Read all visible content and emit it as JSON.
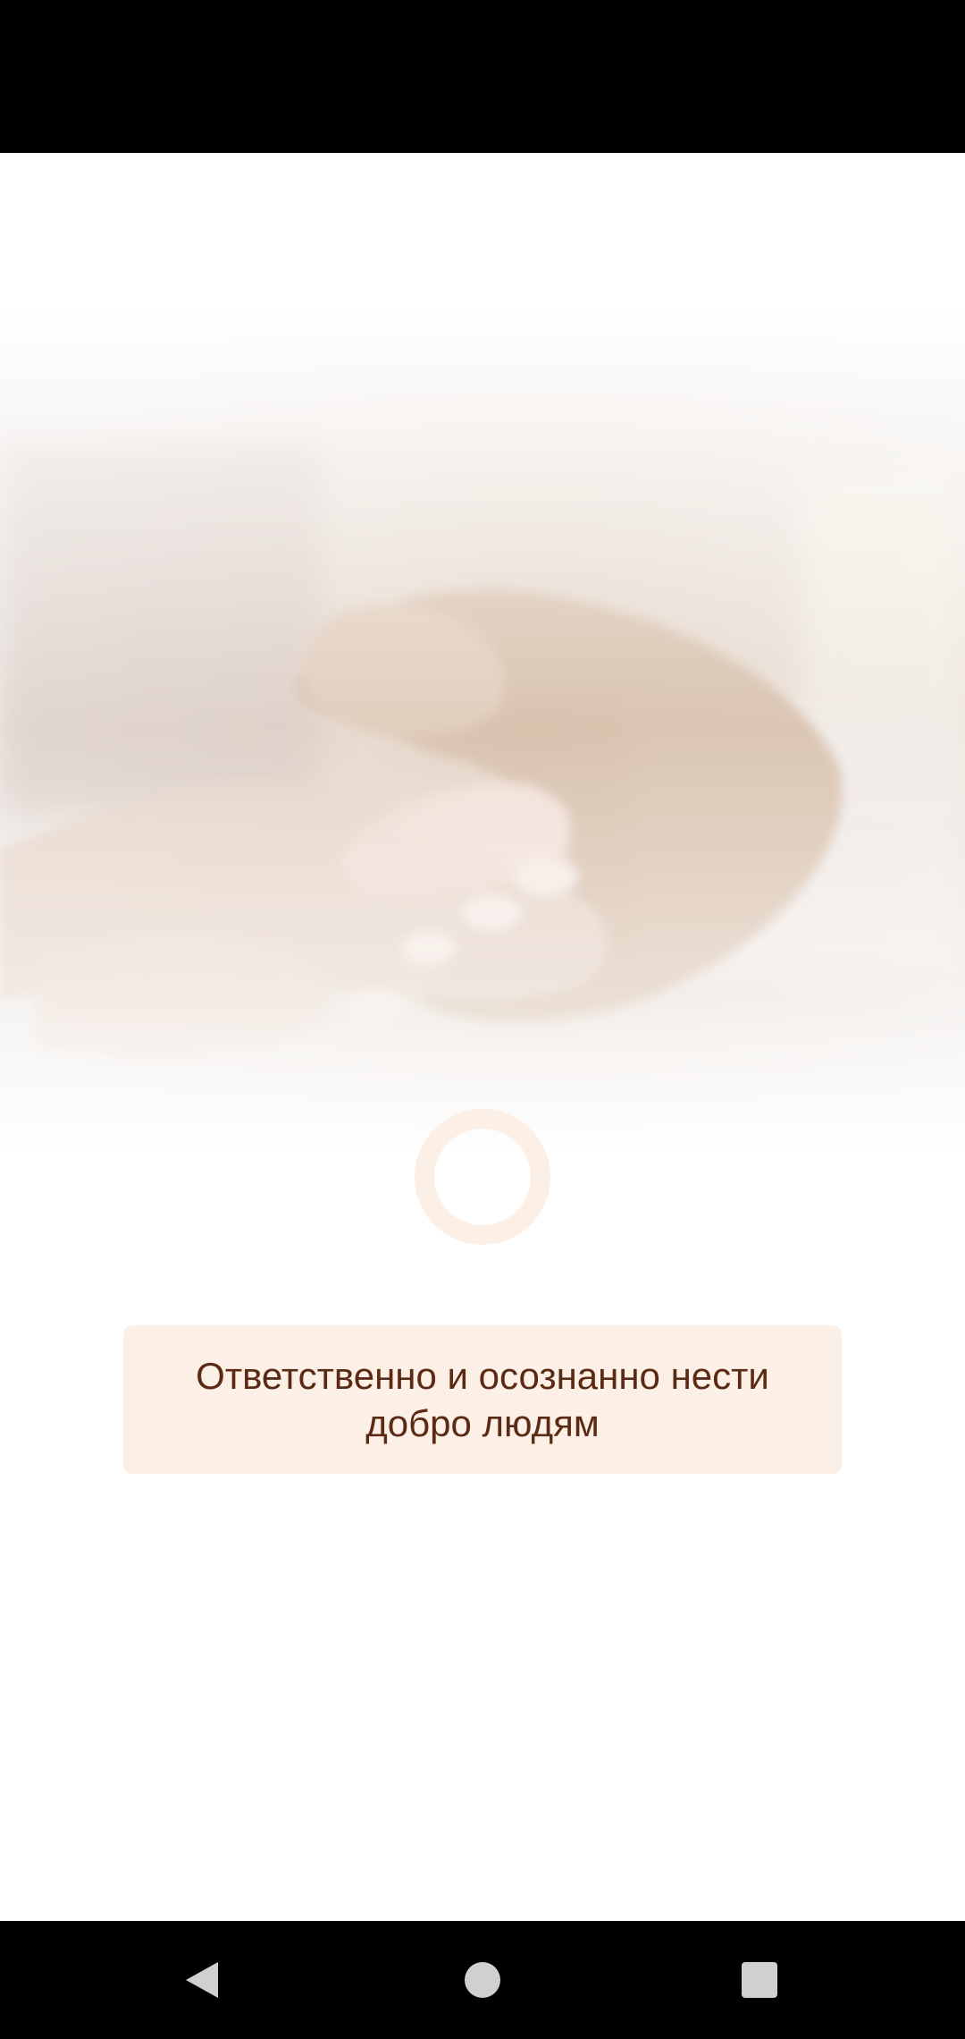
{
  "app": {
    "tagline": "Ответственно и осознанно нести добро людям"
  },
  "hero_image": {
    "description_icon": "holding-hands-image"
  },
  "loading": {
    "icon": "loading-spinner-icon",
    "color": "#fcefe6"
  },
  "colors": {
    "card_background": "#fcefe6",
    "card_text": "#5a2a14",
    "system_bars": "#000000"
  },
  "navigation": {
    "back_icon": "back-triangle-icon",
    "home_icon": "home-circle-icon",
    "recents_icon": "recents-square-icon"
  }
}
